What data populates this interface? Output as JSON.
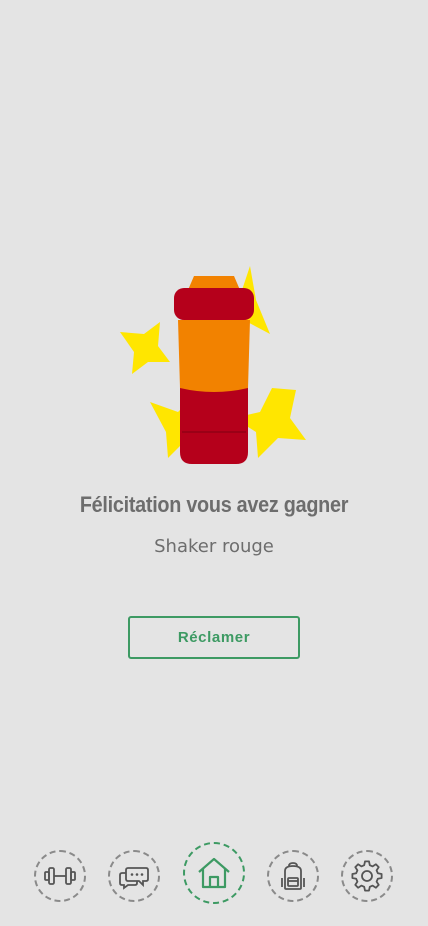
{
  "reward": {
    "title": "Félicitation vous avez gagner",
    "item_name": "Shaker rouge",
    "claim_label": "Réclamer",
    "illustration_icon": "shaker-icon"
  },
  "nav": {
    "items": [
      {
        "name": "workout",
        "icon": "dumbbell-icon",
        "active": false
      },
      {
        "name": "chat",
        "icon": "chat-bubbles-icon",
        "active": false
      },
      {
        "name": "home",
        "icon": "home-icon",
        "active": true
      },
      {
        "name": "backpack",
        "icon": "backpack-icon",
        "active": false
      },
      {
        "name": "settings",
        "icon": "gear-icon",
        "active": false
      }
    ]
  },
  "colors": {
    "background": "#e4e4e4",
    "accent_green": "#3d9a63",
    "text_gray": "#6d6d6d",
    "shaker_red": "#b5001b",
    "shaker_orange": "#f28200",
    "sparkle_yellow": "#ffe600"
  }
}
